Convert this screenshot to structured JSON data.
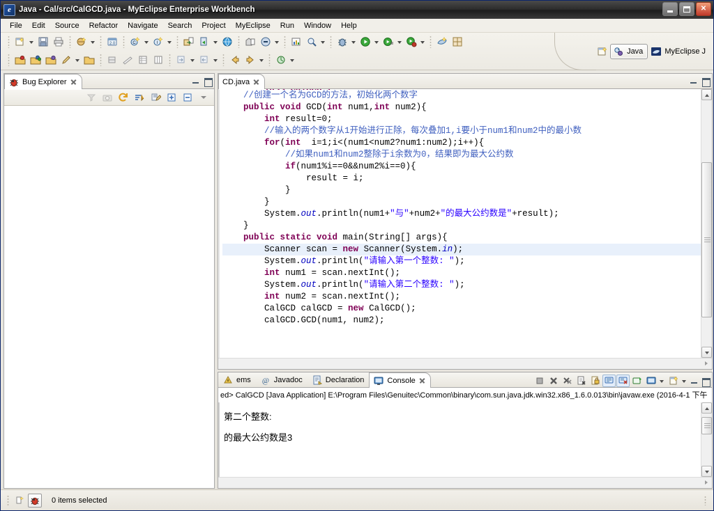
{
  "window": {
    "title": "Java - Cal/src/CalGCD.java - MyEclipse Enterprise Workbench",
    "app_icon": "eclipse-icon",
    "minimize": "minimize-button",
    "restore": "restore-button",
    "close": "close-button"
  },
  "menu": [
    {
      "label": "File"
    },
    {
      "label": "Edit"
    },
    {
      "label": "Source"
    },
    {
      "label": "Refactor"
    },
    {
      "label": "Navigate"
    },
    {
      "label": "Search"
    },
    {
      "label": "Project"
    },
    {
      "label": "MyEclipse"
    },
    {
      "label": "Run"
    },
    {
      "label": "Window"
    },
    {
      "label": "Help"
    }
  ],
  "toolbar": {
    "row1": [
      "new-wizard-icon",
      "save-icon",
      "print-icon",
      "new-java-package-icon",
      "web-browser-icon",
      "new-class-icon",
      "new-interface-icon",
      "export-icon",
      "run-server-icon",
      "globe-icon",
      "deploy-icon",
      "undeploy-icon",
      "chart-icon",
      "search-icon",
      "debug-icon",
      "run-icon",
      "run-history-icon",
      "run-external-icon",
      "myeclipse-icon",
      "layout-icon"
    ],
    "row2": [
      "open-type-icon",
      "open-task-icon",
      "open-resource-icon",
      "pencil-icon",
      "open-folder-icon",
      "toggle-mark-icon",
      "ruler-icon",
      "table-icon",
      "column-icon",
      "next-annotation-icon",
      "prev-annotation-icon",
      "back-icon",
      "forward-icon"
    ]
  },
  "perspectives": {
    "open_perspective_icon": "open-perspective-icon",
    "items": [
      {
        "label": "Java",
        "icon": "java-perspective-icon",
        "active": true
      },
      {
        "label": "MyEclipse J",
        "icon": "myeclipse-perspective-icon",
        "active": false
      }
    ]
  },
  "bug_explorer": {
    "tab_label": "Bug Explorer",
    "tab_icon": "bug-icon",
    "toolbar_icons": [
      "collapse-filter-icon",
      "camera-icon",
      "refresh-icon",
      "sort-icon",
      "edit-filter-icon",
      "expand-all-icon",
      "collapse-all-icon",
      "view-menu-icon"
    ],
    "minimize_icon": "minimize-view-icon",
    "maximize_icon": "maximize-view-icon",
    "body_items": []
  },
  "editor": {
    "tab_label": "CD.java",
    "tab_icon": "java-file-icon",
    "minimize_icon": "minimize-view-icon",
    "maximize_icon": "maximize-view-icon",
    "lines": [
      {
        "indent": 0,
        "clipped": true,
        "tokens": [
          {
            "t": "public class CalGCD {",
            "c": "kw"
          }
        ]
      },
      {
        "indent": 1,
        "tokens": [
          {
            "t": "//创建一个名为GCD的方法，初始化两个数字",
            "c": "cmt"
          }
        ]
      },
      {
        "indent": 1,
        "tokens": [
          {
            "t": "public void ",
            "c": "kw"
          },
          {
            "t": "GCD(",
            "c": ""
          },
          {
            "t": "int ",
            "c": "kw"
          },
          {
            "t": "num1,",
            "c": ""
          },
          {
            "t": "int ",
            "c": "kw"
          },
          {
            "t": "num2){",
            "c": ""
          }
        ]
      },
      {
        "indent": 2,
        "tokens": [
          {
            "t": "int ",
            "c": "kw"
          },
          {
            "t": "result=0;",
            "c": ""
          }
        ]
      },
      {
        "indent": 2,
        "tokens": [
          {
            "t": "//输入的两个数字从1开始进行正除，每次叠加1,i要小于num1和num2中的最小数",
            "c": "cmt"
          }
        ]
      },
      {
        "indent": 2,
        "tokens": [
          {
            "t": "for",
            "c": "kw"
          },
          {
            "t": "(",
            "c": ""
          },
          {
            "t": "int ",
            "c": "kw"
          },
          {
            "t": " i=1;i<(num1<num2?num1:num2);i++){",
            "c": ""
          }
        ]
      },
      {
        "indent": 3,
        "tokens": [
          {
            "t": "//如果num1和num2整除于i余数为0，结果即为最大公约数",
            "c": "cmt"
          }
        ]
      },
      {
        "indent": 3,
        "tokens": [
          {
            "t": "if",
            "c": "kw"
          },
          {
            "t": "(num1%i==0&&num2%i==0){",
            "c": ""
          }
        ]
      },
      {
        "indent": 4,
        "tokens": [
          {
            "t": "result = i;",
            "c": ""
          }
        ]
      },
      {
        "indent": 3,
        "tokens": [
          {
            "t": "}",
            "c": ""
          }
        ]
      },
      {
        "indent": 2,
        "tokens": [
          {
            "t": "}",
            "c": ""
          }
        ]
      },
      {
        "indent": 2,
        "tokens": [
          {
            "t": "System.",
            "c": ""
          },
          {
            "t": "out",
            "c": "fld"
          },
          {
            "t": ".println(num1+",
            "c": ""
          },
          {
            "t": "\"与\"",
            "c": "str"
          },
          {
            "t": "+num2+",
            "c": ""
          },
          {
            "t": "\"的最大公约数是\"",
            "c": "str"
          },
          {
            "t": "+result);",
            "c": ""
          }
        ]
      },
      {
        "indent": 1,
        "tokens": [
          {
            "t": "}",
            "c": ""
          }
        ]
      },
      {
        "indent": 1,
        "tokens": [
          {
            "t": "public static void ",
            "c": "kw"
          },
          {
            "t": "main(String[] args){",
            "c": ""
          }
        ]
      },
      {
        "indent": 2,
        "highlight": true,
        "tokens": [
          {
            "t": "Scanner scan = ",
            "c": ""
          },
          {
            "t": "new ",
            "c": "kw"
          },
          {
            "t": "Scanner(System.",
            "c": ""
          },
          {
            "t": "in",
            "c": "fld"
          },
          {
            "t": ");",
            "c": ""
          }
        ]
      },
      {
        "indent": 2,
        "tokens": [
          {
            "t": "System.",
            "c": ""
          },
          {
            "t": "out",
            "c": "fld"
          },
          {
            "t": ".println(",
            "c": ""
          },
          {
            "t": "\"请输入第一个整数: \"",
            "c": "str"
          },
          {
            "t": ");",
            "c": ""
          }
        ]
      },
      {
        "indent": 2,
        "tokens": [
          {
            "t": "int ",
            "c": "kw"
          },
          {
            "t": "num1 = scan.nextInt();",
            "c": ""
          }
        ]
      },
      {
        "indent": 2,
        "tokens": [
          {
            "t": "System.",
            "c": ""
          },
          {
            "t": "out",
            "c": "fld"
          },
          {
            "t": ".println(",
            "c": ""
          },
          {
            "t": "\"请输入第二个整数: \"",
            "c": "str"
          },
          {
            "t": ");",
            "c": ""
          }
        ]
      },
      {
        "indent": 2,
        "tokens": [
          {
            "t": "int ",
            "c": "kw"
          },
          {
            "t": "num2 = scan.nextInt();",
            "c": ""
          }
        ]
      },
      {
        "indent": 2,
        "tokens": [
          {
            "t": "CalGCD calGCD = ",
            "c": ""
          },
          {
            "t": "new ",
            "c": "kw"
          },
          {
            "t": "CalGCD();",
            "c": ""
          }
        ]
      },
      {
        "indent": 2,
        "tokens": [
          {
            "t": "calGCD.GCD(num1, num2);",
            "c": ""
          }
        ]
      }
    ]
  },
  "bottom_panel": {
    "tabs": [
      {
        "label": "ems",
        "icon": "problems-icon",
        "active": false
      },
      {
        "label": "Javadoc",
        "icon": "javadoc-icon",
        "active": false
      },
      {
        "label": "Declaration",
        "icon": "declaration-icon",
        "active": false
      },
      {
        "label": "Console",
        "icon": "console-icon",
        "active": true
      }
    ],
    "toolbar_icons": [
      "terminate-icon",
      "remove-launch-icon",
      "remove-all-launches-icon",
      "clear-console-icon",
      "scroll-lock-icon",
      "pin-console-icon",
      "display-selected-console-icon",
      "open-console-icon",
      "new-console-view-icon",
      "console-menu-icon"
    ],
    "minimize_icon": "minimize-view-icon",
    "maximize_icon": "maximize-view-icon",
    "launch_line": "ed> CalGCD [Java Application] E:\\Program Files\\Genuitec\\Common\\binary\\com.sun.java.jdk.win32.x86_1.6.0.013\\bin\\javaw.exe (2016-4-1 下午",
    "output": [
      "第二个整数:",
      "的最大公约数是3"
    ]
  },
  "statusbar": {
    "icons": [
      "writable-indicator-icon",
      "bug-status-icon"
    ],
    "text": "0 items selected"
  },
  "colors": {
    "keyword": "#7f0055",
    "comment": "#3f5fbf",
    "string": "#2a00ff",
    "field": "#0000c0",
    "selection_line": "#e8f0fb",
    "titlebar": "#2e2e2e",
    "chrome": "#eceae4"
  }
}
